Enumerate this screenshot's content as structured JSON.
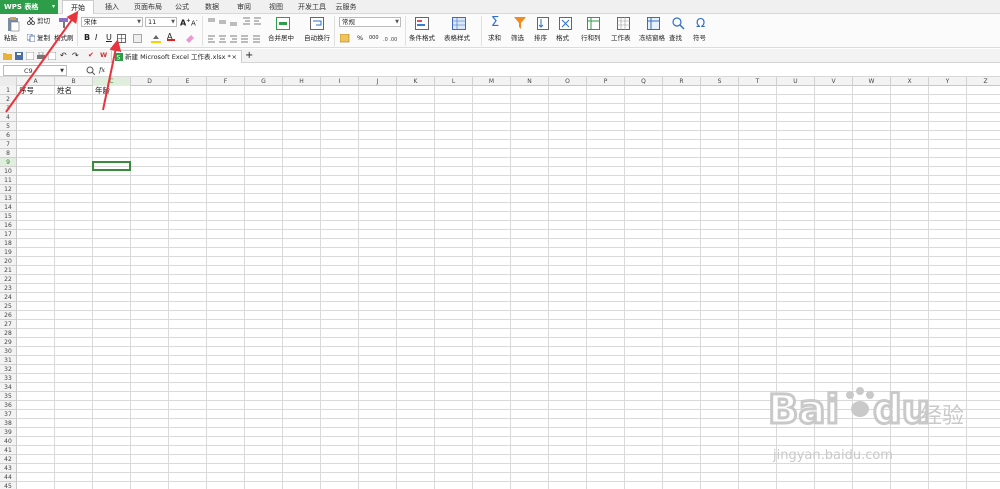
{
  "app": {
    "name": "WPS 表格",
    "dropdown_arrow": "▾"
  },
  "menu_tabs": [
    "开始",
    "插入",
    "页面布局",
    "公式",
    "数据",
    "审阅",
    "视图",
    "开发工具",
    "云服务"
  ],
  "active_tab": "开始",
  "ribbon": {
    "paste": "粘贴",
    "cut": "剪切",
    "copy": "复制",
    "format_painter": "格式刷",
    "font_name": "宋体",
    "font_size": "11",
    "bold": "B",
    "italic": "I",
    "underline": "U",
    "merge_center": "合并居中",
    "wrap_text": "自动换行",
    "number_format": "常规",
    "percent": "%",
    "thousands": "000",
    "conditional_format": "条件格式",
    "table_style": "表格样式",
    "sum": "求和",
    "filter": "筛选",
    "sort": "排序",
    "format": "格式",
    "row_col": "行和列",
    "worksheet": "工作表",
    "freeze": "冻结窗格",
    "find": "查找",
    "symbol": "符号"
  },
  "document_tab": {
    "title": "新建 Microsoft Excel 工作表.xlsx *",
    "close": "×",
    "new_tab": "+"
  },
  "formula_bar": {
    "name_box": "C9",
    "fx": "fx",
    "value": ""
  },
  "columns": [
    "A",
    "B",
    "C",
    "D",
    "E",
    "F",
    "G",
    "H",
    "I",
    "J",
    "K",
    "L",
    "M",
    "N",
    "O",
    "P",
    "Q",
    "R",
    "S",
    "T",
    "U",
    "V",
    "W",
    "X",
    "Y",
    "Z"
  ],
  "row_count": 45,
  "cells": {
    "A1": "序号",
    "B1": "姓名",
    "C1": "年龄"
  },
  "watermark": {
    "brand": "Bai",
    "brand2": "du",
    "cn": "经验",
    "url": "jingyan.baidu.com"
  },
  "colors": {
    "accent": "#2e9d4a",
    "arrow": "#e8343c",
    "selection": "#3a8b3a"
  }
}
